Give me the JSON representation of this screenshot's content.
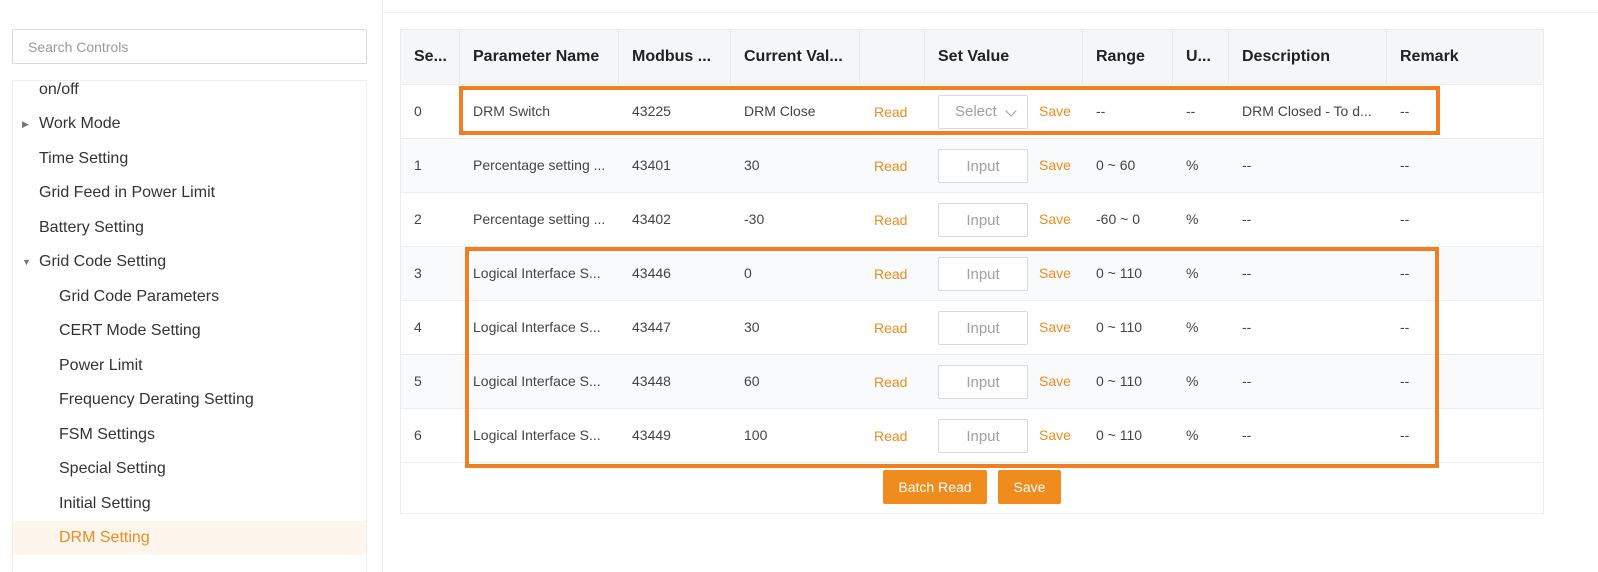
{
  "sidebar": {
    "search_placeholder": "Search Controls",
    "items": [
      {
        "label": "on/off",
        "level": 1
      },
      {
        "label": "Work Mode",
        "level": 1,
        "caret": "collapsed"
      },
      {
        "label": "Time Setting",
        "level": 1
      },
      {
        "label": "Grid Feed in Power Limit",
        "level": 1
      },
      {
        "label": "Battery Setting",
        "level": 1
      },
      {
        "label": "Grid Code Setting",
        "level": 1,
        "caret": "expanded"
      },
      {
        "label": "Grid Code Parameters",
        "level": 2
      },
      {
        "label": "CERT Mode Setting",
        "level": 2
      },
      {
        "label": "Power Limit",
        "level": 2
      },
      {
        "label": "Frequency Derating Setting",
        "level": 2
      },
      {
        "label": "FSM Settings",
        "level": 2
      },
      {
        "label": "Special Setting",
        "level": 2
      },
      {
        "label": "Initial Setting",
        "level": 2
      },
      {
        "label": "DRM Setting",
        "level": 2,
        "active": true
      }
    ]
  },
  "table": {
    "headers": {
      "seq": "Se...",
      "name": "Parameter Name",
      "modbus": "Modbus ...",
      "current": "Current Val...",
      "action": "",
      "set": "Set Value",
      "range": "Range",
      "unit": "U...",
      "desc": "Description",
      "remark": "Remark"
    },
    "rows": [
      {
        "seq": "0",
        "name": "DRM Switch",
        "modbus": "43225",
        "current": "DRM Close",
        "read": "Read",
        "set_type": "select",
        "set_placeholder": "Select",
        "save": "Save",
        "range": "--",
        "unit": "--",
        "desc": "DRM Closed - To d...",
        "remark": "--"
      },
      {
        "seq": "1",
        "name": "Percentage setting ...",
        "modbus": "43401",
        "current": "30",
        "read": "Read",
        "set_type": "input",
        "set_placeholder": "Input",
        "save": "Save",
        "range": "0 ~ 60",
        "unit": "%",
        "desc": "--",
        "remark": "--"
      },
      {
        "seq": "2",
        "name": "Percentage setting ...",
        "modbus": "43402",
        "current": "-30",
        "read": "Read",
        "set_type": "input",
        "set_placeholder": "Input",
        "save": "Save",
        "range": "-60 ~ 0",
        "unit": "%",
        "desc": "--",
        "remark": "--"
      },
      {
        "seq": "3",
        "name": "Logical Interface S...",
        "modbus": "43446",
        "current": "0",
        "read": "Read",
        "set_type": "input",
        "set_placeholder": "Input",
        "save": "Save",
        "range": "0 ~ 110",
        "unit": "%",
        "desc": "--",
        "remark": "--"
      },
      {
        "seq": "4",
        "name": "Logical Interface S...",
        "modbus": "43447",
        "current": "30",
        "read": "Read",
        "set_type": "input",
        "set_placeholder": "Input",
        "save": "Save",
        "range": "0 ~ 110",
        "unit": "%",
        "desc": "--",
        "remark": "--"
      },
      {
        "seq": "5",
        "name": "Logical Interface S...",
        "modbus": "43448",
        "current": "60",
        "read": "Read",
        "set_type": "input",
        "set_placeholder": "Input",
        "save": "Save",
        "range": "0 ~ 110",
        "unit": "%",
        "desc": "--",
        "remark": "--"
      },
      {
        "seq": "6",
        "name": "Logical Interface S...",
        "modbus": "43449",
        "current": "100",
        "read": "Read",
        "set_type": "input",
        "set_placeholder": "Input",
        "save": "Save",
        "range": "0 ~ 110",
        "unit": "%",
        "desc": "--",
        "remark": "--"
      }
    ]
  },
  "actions": {
    "batch_read": "Batch Read",
    "save": "Save"
  },
  "colors": {
    "accent": "#f08b1e",
    "highlight_box": "#f07e23",
    "active_item_bg": "#fef5ed",
    "header_bg": "#f5f6f8"
  }
}
